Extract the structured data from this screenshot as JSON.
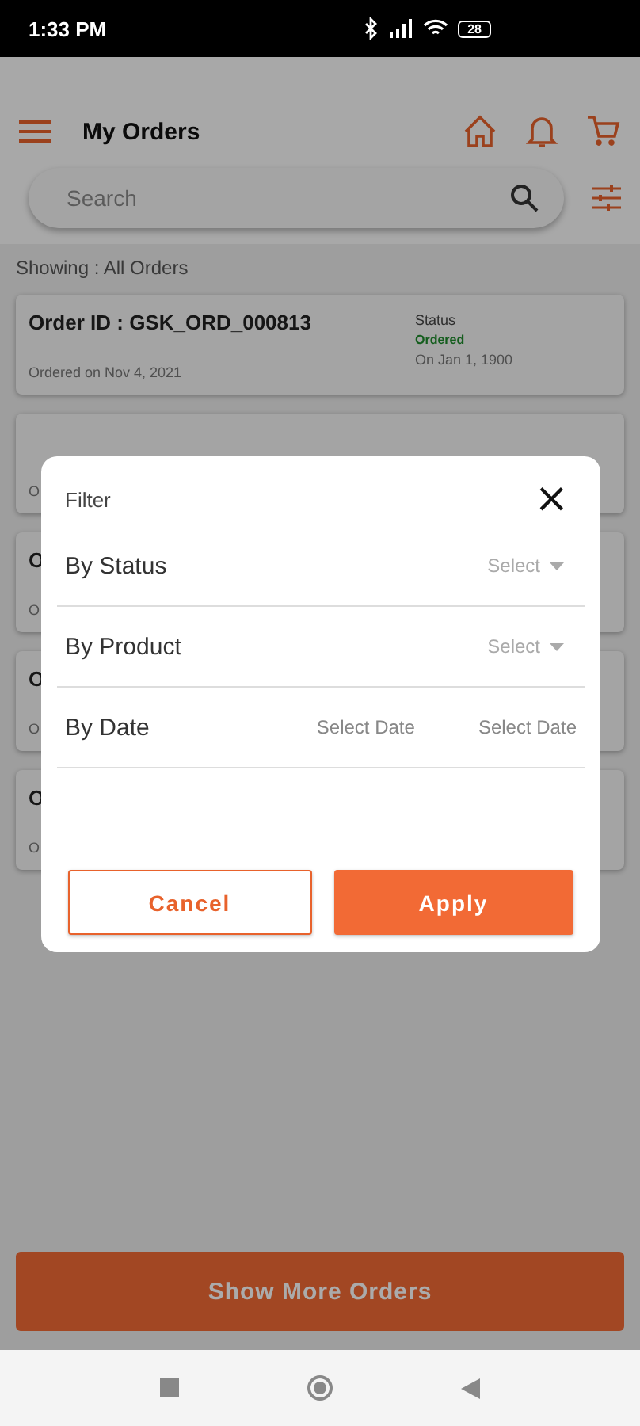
{
  "status_bar": {
    "time": "1:33 PM",
    "battery": "28"
  },
  "header": {
    "title": "My Orders"
  },
  "search": {
    "placeholder": "Search"
  },
  "showing": "Showing : All Orders",
  "orders": [
    {
      "title": "Order ID : GSK_ORD_000813",
      "date": "Ordered on Nov 4, 2021",
      "status_label": "Status",
      "status": "Ordered",
      "status_date": "On Jan 1, 1900"
    },
    {
      "date": "O"
    },
    {
      "title": "O",
      "date": "O"
    },
    {
      "title": "O",
      "date": "O"
    },
    {
      "title": "O",
      "date": "O"
    }
  ],
  "show_more": "Show More Orders",
  "dialog": {
    "title": "Filter",
    "close": "×",
    "rows": [
      {
        "kind": "select",
        "label": "By Status",
        "value": "Select"
      },
      {
        "kind": "select",
        "label": "By Product",
        "value": "Select"
      },
      {
        "kind": "date",
        "label": "By Date",
        "from": "Select Date",
        "to": "Select Date"
      }
    ],
    "cancel": "Cancel",
    "apply": "Apply"
  }
}
